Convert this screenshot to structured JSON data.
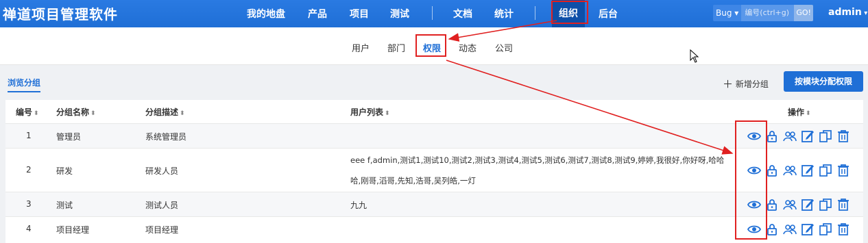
{
  "header": {
    "brand": "禅道项目管理软件",
    "nav": {
      "my": "我的地盘",
      "product": "产品",
      "project": "项目",
      "test": "测试",
      "doc": "文档",
      "report": "统计",
      "company": "组织",
      "admin": "后台"
    },
    "search": {
      "type": "Bug",
      "placeholder": "编号(ctrl+g)",
      "go": "GO!"
    },
    "user": "admin"
  },
  "subnav": {
    "user": "用户",
    "dept": "部门",
    "group": "权限",
    "dynamic": "动态",
    "company": "公司"
  },
  "toolbar": {
    "browse": "浏览分组",
    "add_group": "新增分组",
    "assign": "按模块分配权限"
  },
  "table": {
    "headers": {
      "id": "编号",
      "name": "分组名称",
      "desc": "分组描述",
      "users": "用户列表",
      "actions": "操作"
    },
    "rows": [
      {
        "id": "1",
        "name": "管理员",
        "desc": "系统管理员",
        "users": ""
      },
      {
        "id": "2",
        "name": "研发",
        "desc": "研发人员",
        "users": "eee f,admin,测试1,测试10,测试2,测试3,测试4,测试5,测试6,测试7,测试8,测试9,婷婷,我很好,你好呀,哈哈哈,刚哥,滔哥,先知,浩哥,吴列皓,一灯"
      },
      {
        "id": "3",
        "name": "测试",
        "desc": "测试人员",
        "users": "九九"
      },
      {
        "id": "4",
        "name": "项目经理",
        "desc": "项目经理",
        "users": ""
      }
    ]
  },
  "colors": {
    "accent": "#1f6fd6",
    "annotation": "#e02020",
    "icon": "#1f6fd6"
  }
}
